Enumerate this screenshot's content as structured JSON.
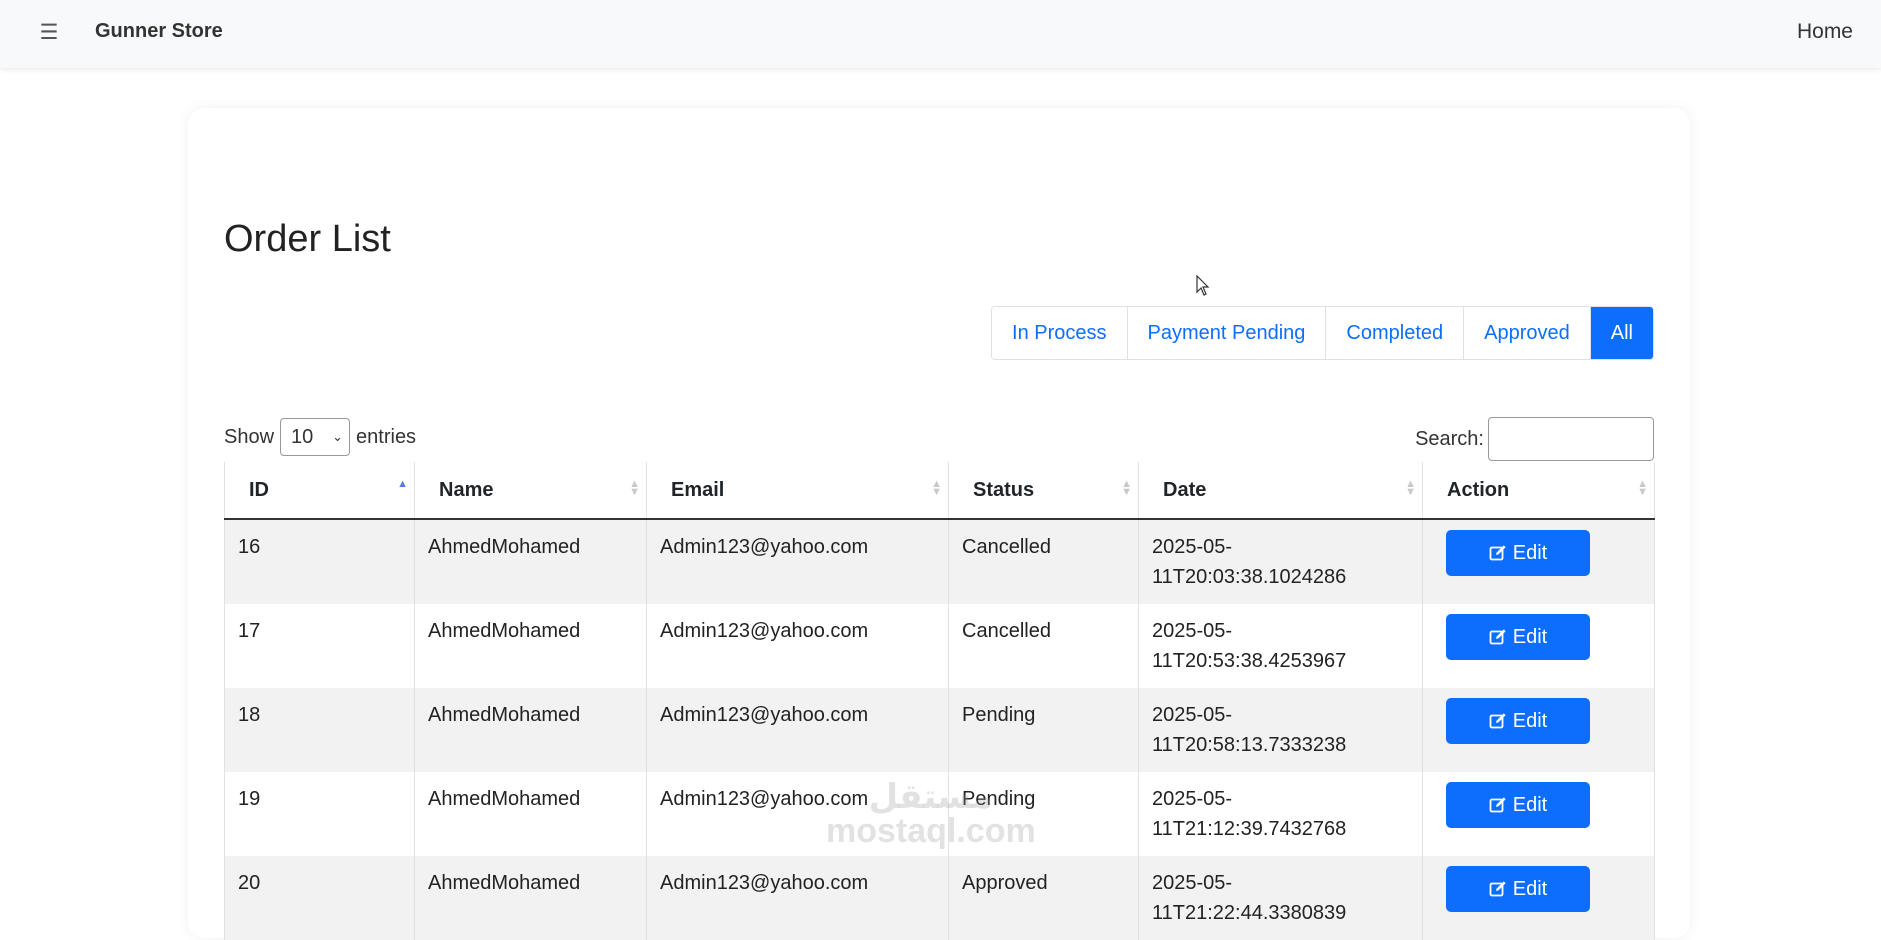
{
  "navbar": {
    "brand": "Gunner Store",
    "home_link": "Home",
    "menu_icon": "hamburger-icon"
  },
  "page": {
    "title": "Order List"
  },
  "filters": {
    "buttons": [
      {
        "label": "In Process",
        "active": false
      },
      {
        "label": "Payment Pending",
        "active": false
      },
      {
        "label": "Completed",
        "active": false
      },
      {
        "label": "Approved",
        "active": false
      },
      {
        "label": "All",
        "active": true
      }
    ]
  },
  "datatable": {
    "show_label": "Show",
    "entries_value": "10",
    "entries_label": "entries",
    "search_label": "Search:",
    "search_value": "",
    "columns": [
      "ID",
      "Name",
      "Email",
      "Status",
      "Date",
      "Action"
    ],
    "sorted_column": "ID",
    "sort_direction": "asc",
    "rows": [
      {
        "id": "16",
        "name": "AhmedMohamed",
        "email": "Admin123@yahoo.com",
        "status": "Cancelled",
        "date_line1": "2025-05-",
        "date_line2": "11T20:03:38.1024286",
        "action": "Edit"
      },
      {
        "id": "17",
        "name": "AhmedMohamed",
        "email": "Admin123@yahoo.com",
        "status": "Cancelled",
        "date_line1": "2025-05-",
        "date_line2": "11T20:53:38.4253967",
        "action": "Edit"
      },
      {
        "id": "18",
        "name": "AhmedMohamed",
        "email": "Admin123@yahoo.com",
        "status": "Pending",
        "date_line1": "2025-05-",
        "date_line2": "11T20:58:13.7333238",
        "action": "Edit"
      },
      {
        "id": "19",
        "name": "AhmedMohamed",
        "email": "Admin123@yahoo.com",
        "status": "Pending",
        "date_line1": "2025-05-",
        "date_line2": "11T21:12:39.7432768",
        "action": "Edit"
      },
      {
        "id": "20",
        "name": "AhmedMohamed",
        "email": "Admin123@yahoo.com",
        "status": "Approved",
        "date_line1": "2025-05-",
        "date_line2": "11T21:22:44.3380839",
        "action": "Edit"
      }
    ]
  },
  "watermark": {
    "arabic": "مستقل",
    "latin": "mostaql.com"
  },
  "colors": {
    "primary": "#0d6efd",
    "navbar_bg": "#f8f9fa",
    "stripe": "#f2f2f2"
  }
}
